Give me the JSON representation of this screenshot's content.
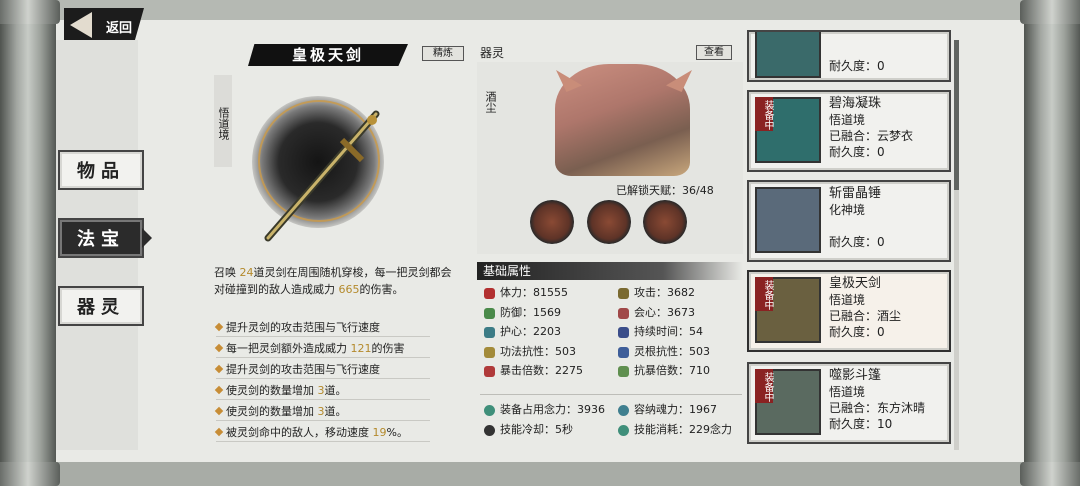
{
  "back": {
    "label": "返回"
  },
  "tabs": [
    {
      "label": "物品"
    },
    {
      "label": "法宝"
    },
    {
      "label": "器灵"
    }
  ],
  "treasure": {
    "name": "皇极天剑",
    "refine_label": "精炼",
    "realm": "悟道境",
    "desc": {
      "p1": "召唤 ",
      "n1": "24",
      "p2": "道灵剑在周围随机穿梭，每一把灵剑都会对碰撞到的敌人造成威力 ",
      "n2": "665",
      "p3": "的伤害。"
    },
    "bullets": [
      {
        "text": "提升灵剑的攻击范围与飞行速度",
        "num": "",
        "tail": ""
      },
      {
        "text": "每一把灵剑额外造成威力 ",
        "num": "121",
        "tail": "的伤害"
      },
      {
        "text": "提升灵剑的攻击范围与飞行速度",
        "num": "",
        "tail": ""
      },
      {
        "text": "使灵剑的数量增加 ",
        "num": "3",
        "tail": "道。"
      },
      {
        "text": "使灵剑的数量增加 ",
        "num": "3",
        "tail": "道。"
      },
      {
        "text": "被灵剑命中的敌人，移动速度 ",
        "num": "19",
        "tail": "%。"
      }
    ]
  },
  "spirit": {
    "heading": "器灵",
    "view_label": "查看",
    "name": "酒尘",
    "talent": "已解锁天赋：",
    "talent_count": "36/48"
  },
  "attributes": {
    "heading": "基础属性",
    "items": [
      {
        "label": "体力：",
        "value": "81555",
        "color": "#b23030"
      },
      {
        "label": "攻击：",
        "value": "3682",
        "color": "#7a6a30"
      },
      {
        "label": "防御：",
        "value": "1569",
        "color": "#4a8a4a"
      },
      {
        "label": "会心：",
        "value": "3673",
        "color": "#a04848"
      },
      {
        "label": "护心：",
        "value": "2203",
        "color": "#3c7c86"
      },
      {
        "label": "持续时间：",
        "value": "54",
        "color": "#3b4e8a"
      },
      {
        "label": "功法抗性：",
        "value": "503",
        "color": "#a38b3a"
      },
      {
        "label": "灵根抗性：",
        "value": "503",
        "color": "#3e5e99"
      },
      {
        "label": "暴击倍数：",
        "value": "2275",
        "color": "#b03a3a"
      },
      {
        "label": "抗暴倍数：",
        "value": "710",
        "color": "#5f8f4f"
      }
    ],
    "extra": [
      {
        "label": "装备占用念力：",
        "value": "3936",
        "color": "#3f8f7a"
      },
      {
        "label": "容纳魂力：",
        "value": "1967",
        "color": "#3f7f8f"
      },
      {
        "label": "技能冷却：",
        "value": "5秒",
        "color": "#333333"
      },
      {
        "label": "技能消耗：",
        "value": "229念力",
        "color": "#3f8f7a"
      }
    ]
  },
  "inventory": {
    "equipped_tag": "装备中",
    "items": [
      {
        "name": "",
        "realm": "",
        "fusion": "",
        "durability": "耐久度：0",
        "equipped": false
      },
      {
        "name": "碧海凝珠",
        "realm": "悟道境",
        "fusion": "已融合：云梦衣",
        "durability": "耐久度：0",
        "equipped": true
      },
      {
        "name": "斩雷晶锤",
        "realm": "化神境",
        "fusion": "",
        "durability": "耐久度：0",
        "equipped": false
      },
      {
        "name": "皇极天剑",
        "realm": "悟道境",
        "fusion": "已融合：酒尘",
        "durability": "耐久度：0",
        "equipped": true
      },
      {
        "name": "噬影斗篷",
        "realm": "悟道境",
        "fusion": "已融合：东方沐晴",
        "durability": "耐久度：10",
        "equipped": true
      }
    ]
  }
}
